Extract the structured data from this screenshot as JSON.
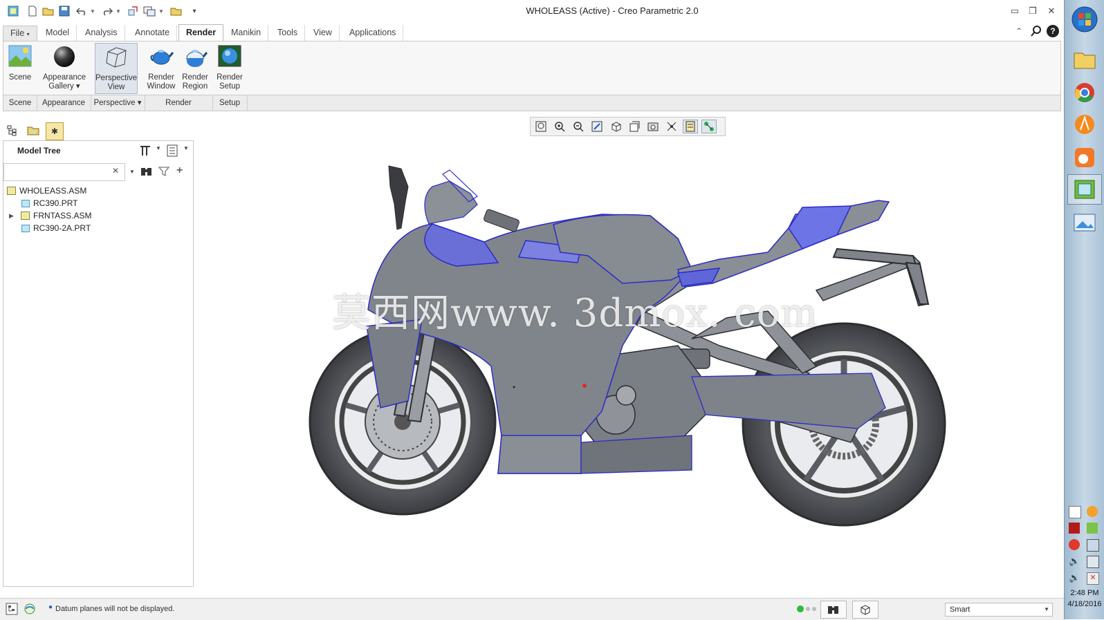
{
  "window": {
    "title": "WHOLEASS (Active) - Creo Parametric 2.0"
  },
  "tabs": [
    "File",
    "Model",
    "Analysis",
    "Annotate",
    "Render",
    "Manikin",
    "Tools",
    "View",
    "Applications"
  ],
  "ribbon": {
    "buttons": [
      {
        "line1": "Scene",
        "line2": ""
      },
      {
        "line1": "Appearance",
        "line2": "Gallery ▾"
      },
      {
        "line1": "Perspective",
        "line2": "View"
      },
      {
        "line1": "Render",
        "line2": "Window"
      },
      {
        "line1": "Render",
        "line2": "Region"
      },
      {
        "line1": "Render",
        "line2": "Setup"
      }
    ],
    "groups": [
      "Scene",
      "Appearance",
      "Perspective ▾",
      "Render",
      "Setup"
    ]
  },
  "model_tree": {
    "title": "Model Tree",
    "search_value": "",
    "items": [
      {
        "label": "WHOLEASS.ASM",
        "type": "asm"
      },
      {
        "label": "RC390.PRT",
        "type": "part"
      },
      {
        "label": "FRNTASS.ASM",
        "type": "asm"
      },
      {
        "label": "RC390-2A.PRT",
        "type": "part"
      }
    ]
  },
  "graphics": {
    "watermark": "莫西网www. 3dmox. com"
  },
  "status": {
    "message": "Datum planes will not be displayed.",
    "filter": "Smart"
  },
  "system": {
    "time": "2:48 PM",
    "date": "4/18/2016"
  },
  "icons": [
    "new-icon",
    "open-icon",
    "save-icon",
    "undo-icon",
    "redo-icon",
    "regenerate-icon",
    "windows-icon",
    "close-window-icon",
    "customize-icon"
  ],
  "colors": {
    "accent_edge": "#2f2fd0",
    "model_gray": "#7c8088",
    "highlight_blue": "#6d74e6"
  }
}
